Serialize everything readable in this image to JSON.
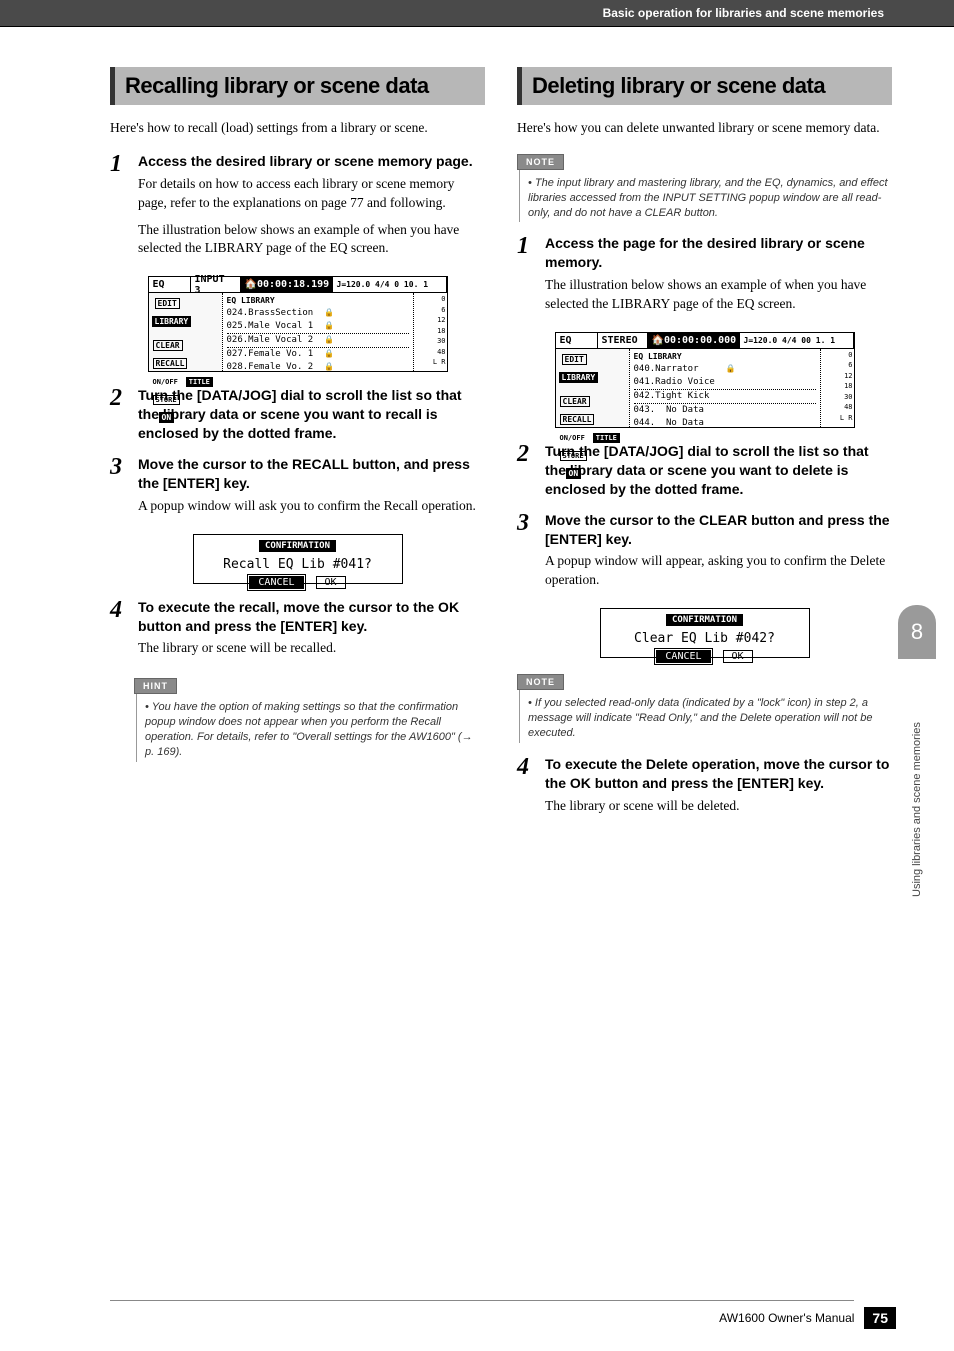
{
  "header": {
    "breadcrumb": "Basic operation for libraries and scene memories"
  },
  "left": {
    "title": "Recalling library or scene data",
    "intro": "Here's how to recall (load) settings from a library or scene.",
    "steps": {
      "1": {
        "head": "Access the desired library or scene memory page.",
        "p1": "For details on how to access each library or scene memory page, refer to the explanations on page 77 and following.",
        "p2": "The illustration below shows an example of when you have selected the LIBRARY page of the EQ screen."
      },
      "2": {
        "head": "Turn the [DATA/JOG] dial to scroll the list so that the library data or scene you want to recall is enclosed by the dotted frame."
      },
      "3": {
        "head": "Move the cursor to the RECALL button, and press the [ENTER] key.",
        "p1": "A popup window will ask you to confirm the Recall operation."
      },
      "4": {
        "head": "To execute the recall, move the cursor to the OK button and press the [ENTER] key.",
        "p1": "The library or scene will be recalled."
      }
    },
    "hint": {
      "label": "HINT",
      "text": "You have the option of making settings so that the confirmation popup window does not appear when you perform the Recall operation. For details, refer to \"Overall settings for the AW1600\" (→ p. 169)."
    },
    "ss": {
      "top": {
        "a": "EQ",
        "b": "INPUT 3",
        "c": "00:00:18.199",
        "d": "J=120.0 4/4 0 10. 1"
      },
      "leftcol": {
        "edit": "EDIT",
        "library": "LIBRARY",
        "clear": "CLEAR",
        "recall": "RECALL",
        "onoff": "ON/OFF",
        "title": "TITLE",
        "store": "STORE",
        "on": "ON"
      },
      "liblabel": "EQ LIBRARY",
      "rows": {
        "r1": "024.BrassSection",
        "r2": "025.Male Vocal 1",
        "r3": "026.Male Vocal 2",
        "r4": "027.Female Vo. 1",
        "r5": "028.Female Vo. 2"
      },
      "meter": {
        "a": "0",
        "b": "6",
        "c": "12",
        "d": "18",
        "e": "30",
        "f": "48",
        "g": "L R"
      }
    },
    "confirm": {
      "title": "CONFIRMATION",
      "q": "Recall   EQ    Lib #041?",
      "cancel": "CANCEL",
      "ok": "OK"
    }
  },
  "right": {
    "title": "Deleting library or scene data",
    "intro": "Here's how you can delete unwanted library or scene memory data.",
    "note1": {
      "label": "NOTE",
      "text": "The input library and mastering library, and the EQ, dynamics, and effect libraries accessed from the INPUT SETTING popup window are all read-only, and do not have a CLEAR button."
    },
    "steps": {
      "1": {
        "head": "Access the page for the desired library or scene memory.",
        "p1": "The illustration below shows an example of when you have selected the LIBRARY page of the EQ screen."
      },
      "2": {
        "head": "Turn the [DATA/JOG] dial to scroll the list so that the library data or scene you want to delete is enclosed by the dotted frame."
      },
      "3": {
        "head": "Move the cursor to the CLEAR button and press the [ENTER] key.",
        "p1": "A popup window will appear, asking you to confirm the Delete operation."
      },
      "4": {
        "head": "To execute the Delete operation, move the cursor to the OK button and press the [ENTER] key.",
        "p1": "The library or scene will be deleted."
      }
    },
    "note2": {
      "label": "NOTE",
      "text": "If you selected read-only data (indicated by a \"lock\" icon) in step 2, a message will indicate \"Read Only,\" and the Delete operation will not be executed."
    },
    "ss": {
      "top": {
        "a": "EQ",
        "b": "STEREO",
        "c": "00:00:00.000",
        "d": "J=120.0 4/4 00 1. 1"
      },
      "leftcol": {
        "edit": "EDIT",
        "library": "LIBRARY",
        "clear": "CLEAR",
        "recall": "RECALL",
        "onoff": "ON/OFF",
        "title": "TITLE",
        "store": "STORE",
        "on": "ON"
      },
      "liblabel": "EQ LIBRARY",
      "rows": {
        "r1": "040.Narrator",
        "r2": "041.Radio Voice",
        "r3": "042.Tight Kick",
        "r4": "043.  No Data",
        "r5": "044.  No Data"
      },
      "meter": {
        "a": "0",
        "b": "6",
        "c": "12",
        "d": "18",
        "e": "30",
        "f": "48",
        "g": "L R"
      }
    },
    "confirm": {
      "title": "CONFIRMATION",
      "q": "Clear    EQ    Lib #042?",
      "cancel": "CANCEL",
      "ok": "OK"
    }
  },
  "sidetab": {
    "num": "8",
    "text": "Using libraries and scene memories"
  },
  "footer": {
    "manual": "AW1600  Owner's Manual",
    "page": "75"
  }
}
